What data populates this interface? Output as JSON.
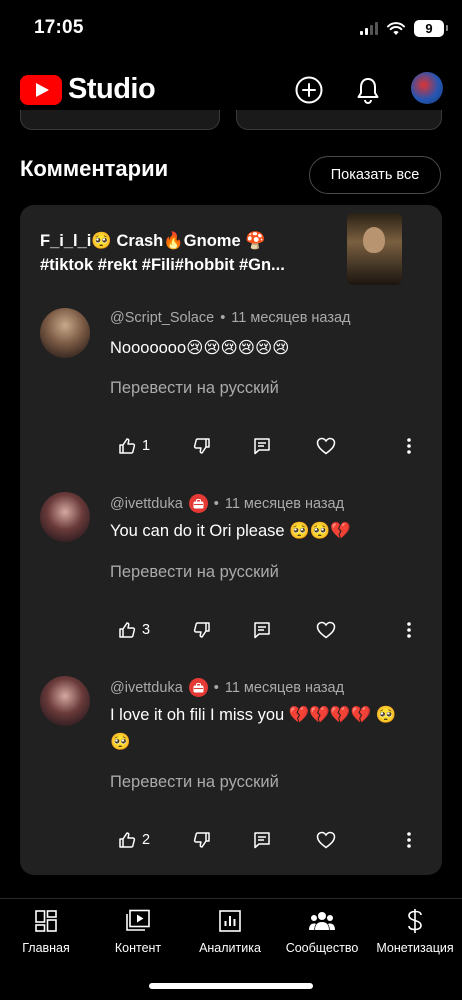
{
  "status_bar": {
    "time": "17:05",
    "battery": "9"
  },
  "header": {
    "brand": "Studio"
  },
  "section": {
    "title": "Комментарии",
    "show_all": "Показать все"
  },
  "video": {
    "title_line1": "F_i_l_i🥺 Crash🔥Gnome 🍄",
    "title_line2": "#tiktok #rekt #Fili#hobbit #Gn..."
  },
  "comments": [
    {
      "author": "@Script_Solace",
      "time": "11 месяцев назад",
      "text": "Nooooooo😢😢😢😢😢😢",
      "translate": "Перевести на русский",
      "likes": "1",
      "has_badge": false
    },
    {
      "author": "@ivettduka",
      "time": "11 месяцев назад",
      "text": "You can do it Ori please 🥺🥺💔",
      "translate": "Перевести на русский",
      "likes": "3",
      "has_badge": true
    },
    {
      "author": "@ivettduka",
      "time": "11 месяцев назад",
      "text": "I love it oh fili I miss you 💔💔💔💔 🥺🥺",
      "translate": "Перевести на русский",
      "likes": "2",
      "has_badge": true
    }
  ],
  "separator": "•",
  "nav": [
    {
      "label": "Главная",
      "icon": "dashboard-icon"
    },
    {
      "label": "Контент",
      "icon": "content-icon"
    },
    {
      "label": "Аналитика",
      "icon": "analytics-icon"
    },
    {
      "label": "Сообщество",
      "icon": "community-icon"
    },
    {
      "label": "Монетизация",
      "icon": "monetization-icon"
    }
  ],
  "colors": {
    "background": "#000000",
    "card": "#212121",
    "brand_red": "#ff0000",
    "secondary_text": "#aaaaaa"
  }
}
